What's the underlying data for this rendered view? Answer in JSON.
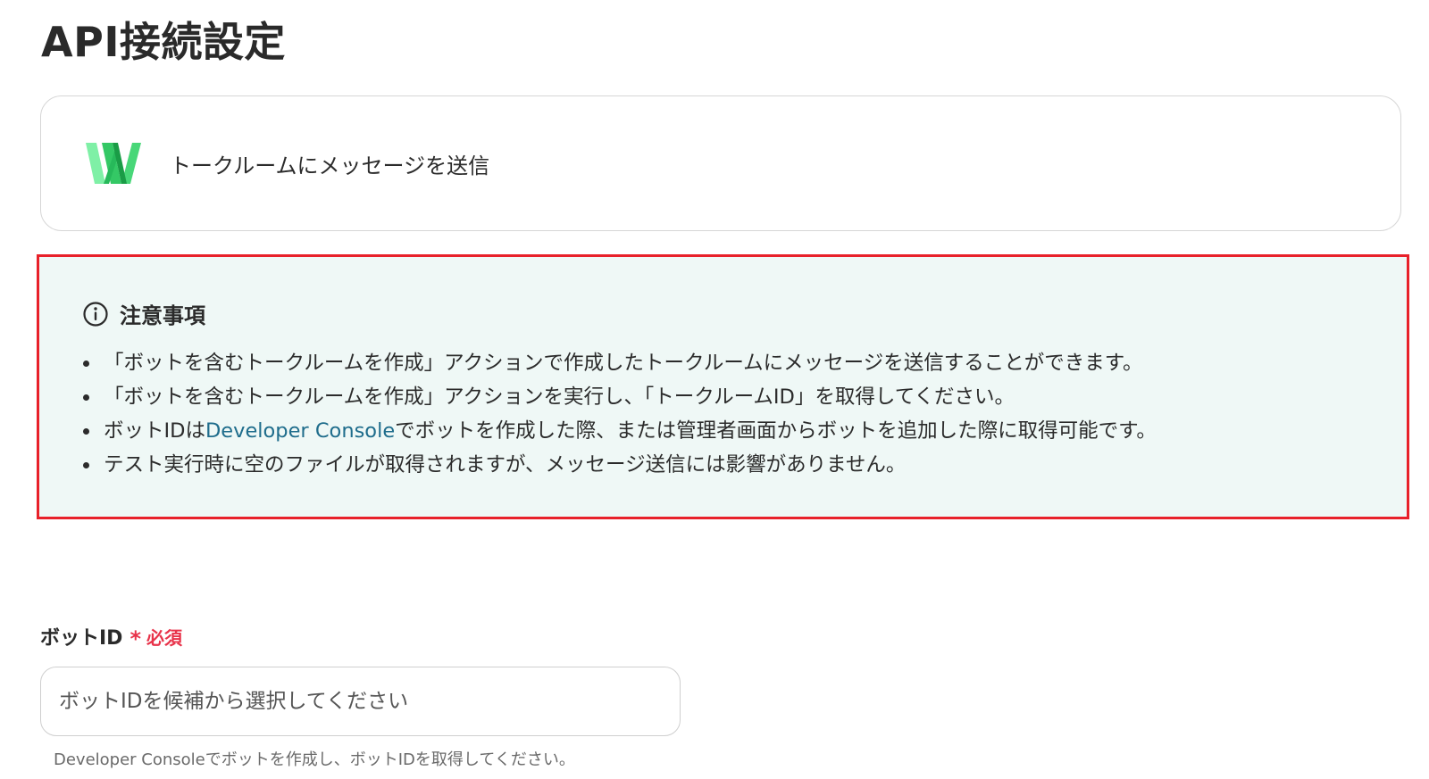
{
  "page": {
    "title": "API接続設定"
  },
  "action": {
    "app_icon": "line-works-logo",
    "label": "トークルームにメッセージを送信"
  },
  "notice": {
    "icon": "info-icon",
    "title": "注意事項",
    "items": [
      "「ボットを含むトークルームを作成」アクションで作成したトークルームにメッセージを送信することができます。",
      "「ボットを含むトークルームを作成」アクションを実行し、「トークルームID」を取得してください。",
      "",
      "テスト実行時に空のファイルが取得されますが、メッセージ送信には影響がありません。"
    ],
    "item3": {
      "before": "ボットIDは",
      "link": "Developer Console",
      "after": "でボットを作成した際、または管理者画面からボットを追加した際に取得可能です。"
    }
  },
  "form": {
    "bot_id": {
      "label": "ボットID",
      "required_mark": "*",
      "required_text": "必須",
      "placeholder": "ボットIDを候補から選択してください",
      "help": "Developer Consoleでボットを作成し、ボットIDを取得してください。"
    }
  },
  "colors": {
    "notice_border": "#e8212a",
    "notice_bg": "#eff8f6",
    "link": "#1f6d8c",
    "required": "#e8334a",
    "logo_green_light": "#5ee38a",
    "logo_green_dark": "#1fae4f"
  }
}
